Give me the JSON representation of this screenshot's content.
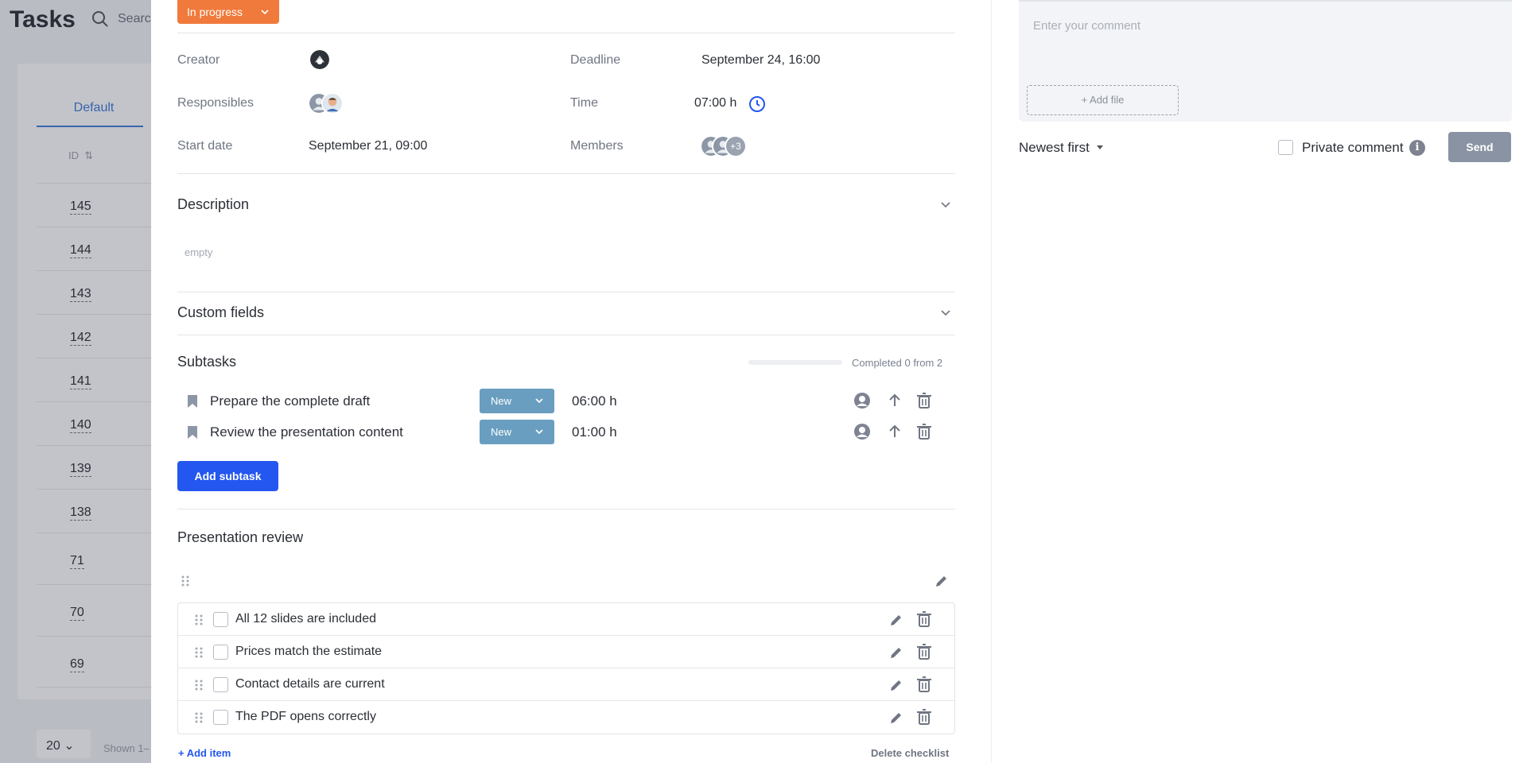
{
  "background": {
    "title": "Tasks",
    "search_placeholder": "Search",
    "tab_default": "Default",
    "id_header": "ID",
    "rows": [
      "145",
      "144",
      "143",
      "142",
      "141",
      "140",
      "139",
      "138",
      "71",
      "70",
      "69"
    ],
    "per_page": "20",
    "shown": "Shown 1–"
  },
  "task": {
    "status": "In progress",
    "creator_label": "Creator",
    "responsibles_label": "Responsibles",
    "start_label": "Start date",
    "start_value": "September 21, 09:00",
    "deadline_label": "Deadline",
    "deadline_value": "September 24, 16:00",
    "time_label": "Time",
    "time_value": "07:00 h",
    "members_label": "Members",
    "members_more": "+3",
    "description_title": "Description",
    "description_value": "empty",
    "custom_fields_title": "Custom fields",
    "subtasks_title": "Subtasks",
    "subtasks_completed_text": "Completed 0 from 2",
    "subtasks_completed_fraction": 0,
    "subtasks": [
      {
        "name": "Prepare the complete draft",
        "status": "New",
        "time": "06:00 h"
      },
      {
        "name": "Review the presentation content",
        "status": "New",
        "time": "01:00 h"
      }
    ],
    "add_subtask": "Add subtask",
    "checklist_title": "Presentation review",
    "checklist_items": [
      {
        "text": "All 12 slides are included",
        "checked": false
      },
      {
        "text": "Prices match the estimate",
        "checked": false
      },
      {
        "text": "Contact details are current",
        "checked": false
      },
      {
        "text": "The PDF opens correctly",
        "checked": false
      }
    ],
    "add_item": "+ Add item",
    "delete_checklist": "Delete checklist"
  },
  "comments": {
    "placeholder": "Enter your comment",
    "add_file": "+ Add file",
    "sort": "Newest first",
    "private_label": "Private comment",
    "send": "Send"
  },
  "colors": {
    "status_in_progress": "#f07a3c",
    "subtask_status": "#6a9ec0",
    "primary": "#2457f0",
    "send_disabled": "#8a93a3"
  }
}
